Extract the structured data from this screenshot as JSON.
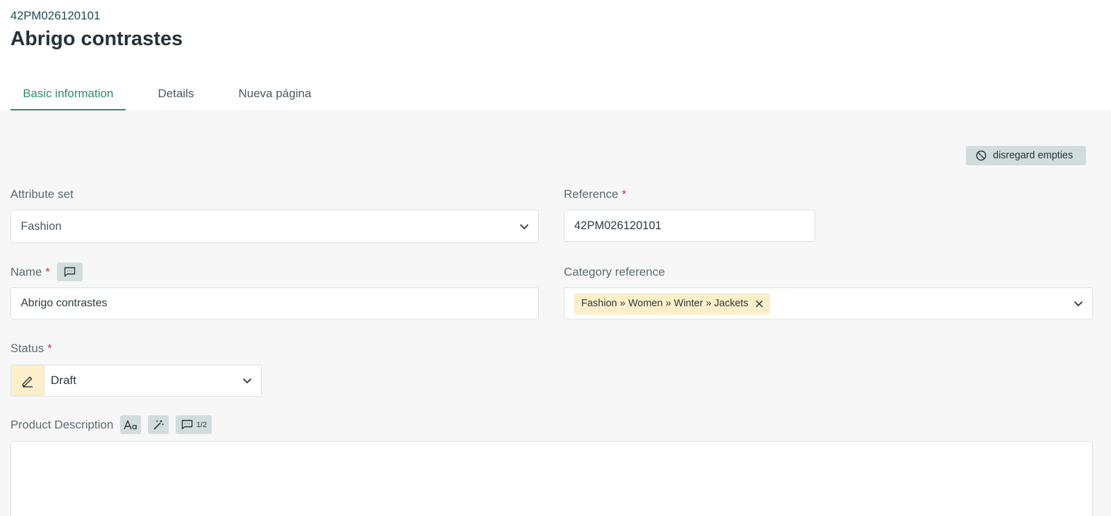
{
  "header": {
    "product_code": "42PM026120101",
    "title": "Abrigo contrastes"
  },
  "tabs": [
    {
      "label": "Basic information",
      "active": true
    },
    {
      "label": "Details",
      "active": false
    },
    {
      "label": "Nueva página",
      "active": false
    }
  ],
  "toolbar": {
    "disregard_label": "disregard empties"
  },
  "fields": {
    "attribute_set": {
      "label": "Attribute set",
      "value": "Fashion"
    },
    "reference": {
      "label": "Reference",
      "required_mark": "*",
      "value": "42PM026120101"
    },
    "name": {
      "label": "Name",
      "required_mark": "*",
      "value": "Abrigo contrastes"
    },
    "category_reference": {
      "label": "Category reference",
      "chip": "Fashion » Women » Winter » Jackets"
    },
    "status": {
      "label": "Status",
      "required_mark": "*",
      "value": "Draft"
    },
    "product_description": {
      "label": "Product Description",
      "comment_count": "1/2",
      "value": ""
    }
  },
  "colors": {
    "accent": "#2e8a6f",
    "required": "#d0343a",
    "chip_bg": "#fcefc9",
    "button_bg": "#d3dcdc"
  }
}
